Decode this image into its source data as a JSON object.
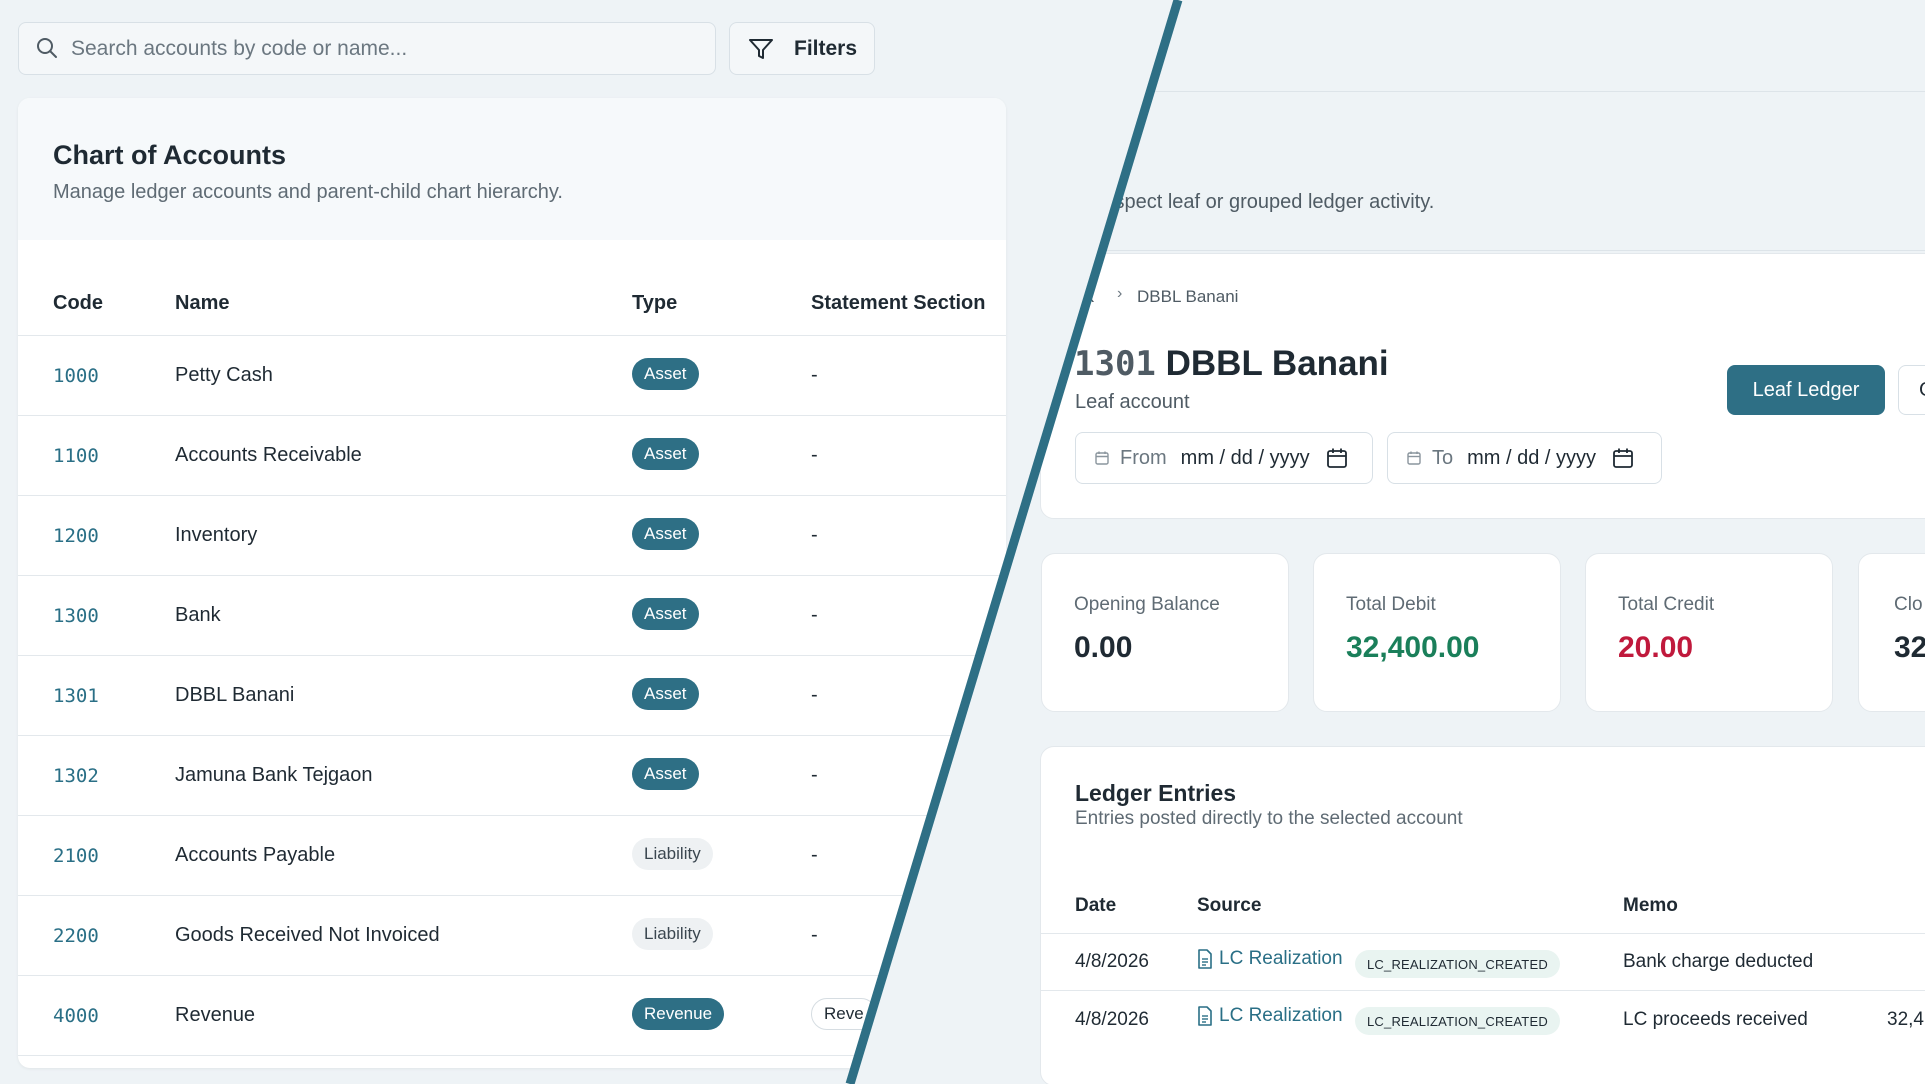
{
  "search": {
    "placeholder": "Search accounts by code or name..."
  },
  "filters_label": "Filters",
  "chart_of_accounts": {
    "title": "Chart of Accounts",
    "subtitle": "Manage ledger accounts and parent-child chart hierarchy.",
    "columns": [
      "Code",
      "Name",
      "Type",
      "Statement Section"
    ],
    "rows": [
      {
        "code": "1000",
        "name": "Petty Cash",
        "type": "Asset",
        "section": "-"
      },
      {
        "code": "1100",
        "name": "Accounts Receivable",
        "type": "Asset",
        "section": "-"
      },
      {
        "code": "1200",
        "name": "Inventory",
        "type": "Asset",
        "section": "-"
      },
      {
        "code": "1300",
        "name": "Bank",
        "type": "Asset",
        "section": "-"
      },
      {
        "code": "1301",
        "name": "DBBL Banani",
        "type": "Asset",
        "section": "-"
      },
      {
        "code": "1302",
        "name": "Jamuna Bank Tejgaon",
        "type": "Asset",
        "section": "-"
      },
      {
        "code": "2100",
        "name": "Accounts Payable",
        "type": "Liability",
        "section": "-"
      },
      {
        "code": "2200",
        "name": "Goods Received Not Invoiced",
        "type": "Liability",
        "section": "-"
      },
      {
        "code": "4000",
        "name": "Revenue",
        "type": "Revenue",
        "section": "Reve"
      }
    ]
  },
  "ledger": {
    "subtitle_fragment": "and inspect leaf or grouped ledger activity.",
    "breadcrumb": {
      "parent": "nk",
      "current": "DBBL Banani"
    },
    "account_code": "1301",
    "account_name": "DBBL Banani",
    "account_kind": "Leaf account",
    "from_label": "From",
    "to_label": "To",
    "date_placeholder": "mm / dd / yyyy",
    "leaf_button": "Leaf Ledger",
    "group_button_fragment": "G",
    "stats": [
      {
        "label": "Opening Balance",
        "value": "0.00",
        "color": "#1f2a33"
      },
      {
        "label": "Total Debit",
        "value": "32,400.00",
        "color": "#1a7f5a"
      },
      {
        "label": "Total Credit",
        "value": "20.00",
        "color": "#c0193c"
      },
      {
        "label": "Clo",
        "value": "32",
        "color": "#1f2a33"
      }
    ],
    "entries_title": "Ledger Entries",
    "entries_subtitle": "Entries posted directly to the selected account",
    "columns": [
      "Date",
      "Source",
      "Memo"
    ],
    "entries": [
      {
        "date": "4/8/2026",
        "source": "LC Realization",
        "tag": "LC_REALIZATION_CREATED",
        "memo": "Bank charge deducted",
        "amount": ""
      },
      {
        "date": "4/8/2026",
        "source": "LC Realization",
        "tag": "LC_REALIZATION_CREATED",
        "memo": "LC proceeds received",
        "amount": "32,4"
      }
    ]
  },
  "colors": {
    "accent": "#2e6f85",
    "debit": "#1a7f5a",
    "credit": "#c0193c",
    "divider": "#2e6f85"
  }
}
